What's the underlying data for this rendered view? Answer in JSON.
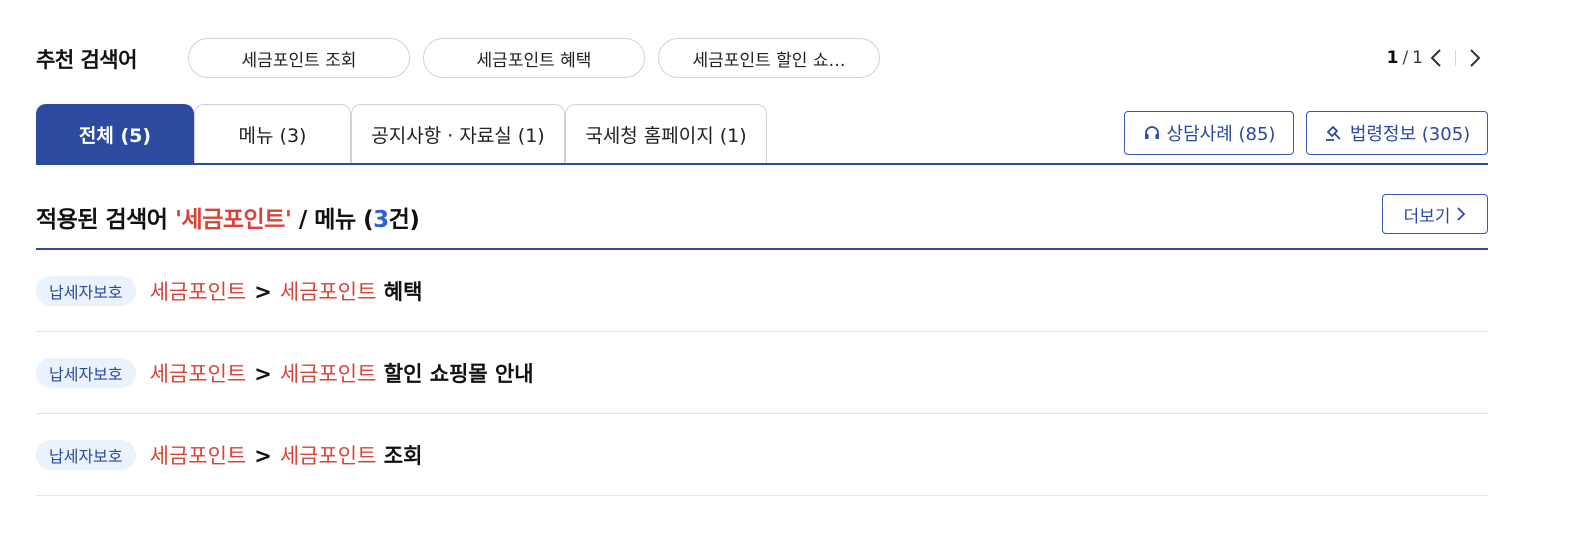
{
  "recommended": {
    "title": "추천 검색어",
    "chips": [
      "세금포인트 조회",
      "세금포인트 혜택",
      "세금포인트 할인 쇼…"
    ],
    "pager": {
      "current": "1",
      "separator": "/",
      "total": "1"
    }
  },
  "tabs": [
    {
      "label": "전체 (5)",
      "active": true
    },
    {
      "label": "메뉴 (3)"
    },
    {
      "label": "공지사항 · 자료실 (1)"
    },
    {
      "label": "국세청 홈페이지 (1)"
    }
  ],
  "side_buttons": {
    "consult": {
      "label": "상담사례 (85)",
      "icon": "headset-icon"
    },
    "law": {
      "label": "법령정보 (305)",
      "icon": "gavel-icon"
    }
  },
  "section": {
    "prefix": "적용된 검색어 ",
    "keyword": "'세금포인트'",
    "middle": " / 메뉴 (",
    "count": "3",
    "suffix": "건)",
    "more_label": "더보기"
  },
  "results": [
    {
      "badge": "납세자보호",
      "crumb1": "세금포인트",
      "sep": ">",
      "crumb2": "세금포인트",
      "rest": "혜택"
    },
    {
      "badge": "납세자보호",
      "crumb1": "세금포인트",
      "sep": ">",
      "crumb2": "세금포인트",
      "rest": "할인 쇼핑몰 안내"
    },
    {
      "badge": "납세자보호",
      "crumb1": "세금포인트",
      "sep": ">",
      "crumb2": "세금포인트",
      "rest": "조회"
    }
  ],
  "colors": {
    "accent": "#2b4aa0",
    "highlight": "#d9443a",
    "count": "#2f5fd6",
    "badge_bg": "#eaf2fb"
  }
}
